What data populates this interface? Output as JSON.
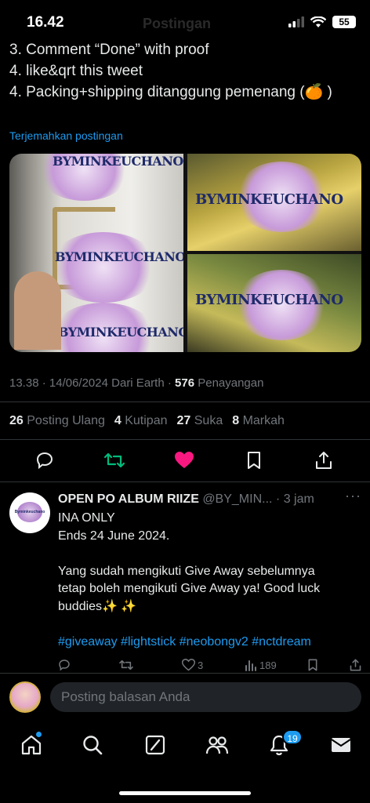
{
  "status_bar": {
    "time": "16.42",
    "battery": "55"
  },
  "header": {
    "title": "Postingan"
  },
  "tweet": {
    "lines": [
      "3. Comment “Done” with proof",
      "4. like&qrt this tweet",
      "4. Packing+shipping ditanggung pemenang (🍊 )"
    ],
    "translate_label": "Terjemahkan postingan",
    "media_watermark": "BYMINKEUCHANO",
    "meta": {
      "time": "13.38",
      "date": "14/06/2024",
      "source": "Dari Earth",
      "views": "576",
      "views_label": "Penayangan"
    },
    "stats": {
      "reposts": "26",
      "reposts_label": "Posting Ulang",
      "quotes": "4",
      "quotes_label": "Kutipan",
      "likes": "27",
      "likes_label": "Suka",
      "bookmarks": "8",
      "bookmarks_label": "Markah"
    },
    "action_colors": {
      "repost": "#00ba7c",
      "like": "#f91880"
    }
  },
  "reply": {
    "avatar_text": "Byminkeuchano",
    "name": "OPEN PO ALBUM RIIZE",
    "handle": "@BY_MIN...",
    "time": "· 3 jam",
    "more": "···",
    "body": [
      "INA ONLY",
      "Ends 24 June 2024.",
      "",
      "Yang sudah mengikuti Give Away sebelumnya",
      "tetap boleh mengikuti Give Away ya! Good luck",
      "buddies✨ ✨",
      ""
    ],
    "hashtags": "#giveaway #lightstick #neobongv2 #nctdream",
    "actions": {
      "likes": "3",
      "views": "189"
    }
  },
  "composer": {
    "placeholder": "Posting balasan Anda"
  },
  "tabbar": {
    "notifications_badge": "19"
  },
  "colors": {
    "accent": "#1d9bf0",
    "background": "#000000"
  }
}
